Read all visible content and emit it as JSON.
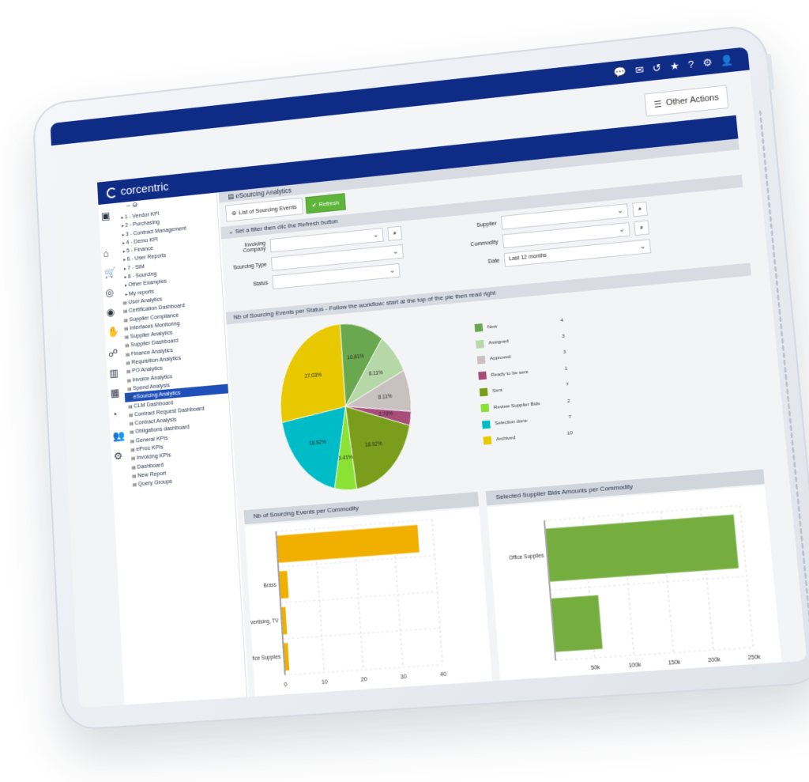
{
  "topbar": {
    "icons": [
      "chat-icon",
      "mail-icon",
      "history-icon",
      "star-icon",
      "help-icon",
      "gear-icon",
      "user-icon"
    ],
    "glyphs": [
      "💬",
      "✉",
      "↺",
      "★",
      "?",
      "⚙",
      "👤"
    ]
  },
  "other_actions_label": "Other Actions",
  "brand": {
    "name": "corcentric"
  },
  "rail_icons": [
    "sidebar-toggle-icon",
    "home-icon",
    "cart-icon",
    "coins-icon",
    "chart-search-icon",
    "handshake-icon",
    "hand-coins-icon",
    "bar-chart-icon",
    "dashboard-icon",
    "gauge-icon",
    "users-icon",
    "gears-icon"
  ],
  "rail_glyphs": [
    "▣",
    "⌂",
    "🛒",
    "◎",
    "◉",
    "✋",
    "☍",
    "▥",
    "▦",
    "◔",
    "👥",
    "⚙"
  ],
  "tree": {
    "head": "– ⊖",
    "items": [
      {
        "label": "1 - Vendor KPI",
        "kind": "caret"
      },
      {
        "label": "2 - Purchasing",
        "kind": "caret"
      },
      {
        "label": "3 - Contract Management",
        "kind": "caret"
      },
      {
        "label": "4 - Demo KPI",
        "kind": "caret"
      },
      {
        "label": "5 - Finance",
        "kind": "caret"
      },
      {
        "label": "6 - User Reports",
        "kind": "caret"
      },
      {
        "label": "7 - SIM",
        "kind": "caret"
      },
      {
        "label": "8 - Sourcing",
        "kind": "caret"
      },
      {
        "label": "Other Examples",
        "kind": "caret"
      },
      {
        "label": "My reports",
        "kind": "caret"
      },
      {
        "label": "User Analytics",
        "kind": "lvl2"
      },
      {
        "label": "Certification Dashboard",
        "kind": "lvl2"
      },
      {
        "label": "Supplier Compliance",
        "kind": "lvl2"
      },
      {
        "label": "Interfaces Monitoring",
        "kind": "lvl2"
      },
      {
        "label": "Supplier Analytics",
        "kind": "lvl2"
      },
      {
        "label": "Supplier Dashboard",
        "kind": "lvl2"
      },
      {
        "label": "Finance Analytics",
        "kind": "lvl2"
      },
      {
        "label": "Requisition Analytics",
        "kind": "lvl2"
      },
      {
        "label": "PO Analytics",
        "kind": "lvl2"
      },
      {
        "label": "Invoice Analytics",
        "kind": "lvl2"
      },
      {
        "label": "Spend Analysis",
        "kind": "lvl2"
      },
      {
        "label": "eSourcing Analytics",
        "kind": "lvl2",
        "selected": true
      },
      {
        "label": "CLM Dashboard",
        "kind": "lvl2"
      },
      {
        "label": "Contract Request Dashboard",
        "kind": "lvl2"
      },
      {
        "label": "Contract Analysis",
        "kind": "lvl2"
      },
      {
        "label": "Obligations dashboard",
        "kind": "lvl2"
      },
      {
        "label": "General KPIs",
        "kind": "lvl2"
      },
      {
        "label": "eProc KPIs",
        "kind": "lvl2"
      },
      {
        "label": "Invoicing KPIs",
        "kind": "lvl2"
      },
      {
        "label": "Dashboard",
        "kind": "lvl2"
      },
      {
        "label": "New Report",
        "kind": "lvl2"
      },
      {
        "label": "Query Groups",
        "kind": "lvl2"
      }
    ]
  },
  "main": {
    "title": "eSourcing Analytics",
    "list_button": "List of Sourcing Events",
    "refresh_button": "Refresh",
    "filter_section": "Set a filter then clic the Refresh button",
    "filters": {
      "invoicing_company_label": "Invoicing Company",
      "sourcing_type_label": "Sourcing Type",
      "status_label": "Status",
      "supplier_label": "Supplier",
      "commodity_label": "Commodity",
      "date_label": "Date",
      "date_value": "Last 12 months"
    },
    "pie_section": "Nb of Sourcing Events per Status - Follow the workflow: start at the top of the pie then read right",
    "commodity_section": "Nb of Sourcing Events per Commodity",
    "bids_section": "Selected Supplier Bids Amounts per Commodity"
  },
  "chart_data": [
    {
      "type": "pie",
      "title": "Nb of Sourcing Events per Status - Follow the workflow: start at the top of the pie then read right",
      "slices": [
        {
          "name": "New",
          "value": 4,
          "label": "10.81%",
          "color": "#6aa84f"
        },
        {
          "name": "Assigned",
          "value": 3,
          "label": "8.11%",
          "color": "#b6d7a8"
        },
        {
          "name": "Approved",
          "value": 3,
          "label": "8.11%",
          "color": "#c9c0c0"
        },
        {
          "name": "Ready to be sent",
          "value": 1,
          "label": "2.70%",
          "color": "#a64d79"
        },
        {
          "name": "Sent",
          "value": 7,
          "label": "18.92%",
          "color": "#7a9e1c"
        },
        {
          "name": "Review Supplier Bids",
          "value": 2,
          "label": "5.41%",
          "color": "#8ae234"
        },
        {
          "name": "Selection done",
          "value": 7,
          "label": "18.92%",
          "color": "#00bcc6"
        },
        {
          "name": "Archived",
          "value": 10,
          "label": "27.03%",
          "color": "#e8c800"
        }
      ]
    },
    {
      "type": "bar",
      "orientation": "horizontal",
      "title": "Nb of Sourcing Events per Commodity",
      "categories": [
        "",
        "Brass",
        "Advertising, TV",
        "Office Supplies"
      ],
      "values": [
        36,
        2,
        1,
        1
      ],
      "xticks": [
        0,
        10,
        20,
        30,
        40
      ],
      "xlim": [
        0,
        40
      ],
      "color": "#f1b000"
    },
    {
      "type": "bar",
      "orientation": "horizontal",
      "title": "Selected Supplier Bids Amounts per Commodity",
      "categories": [
        "Office Supplies",
        ""
      ],
      "values": [
        240000,
        60000
      ],
      "xticks": [
        "50k",
        "100k",
        "150k",
        "200k",
        "250k"
      ],
      "xlim": [
        0,
        250000
      ],
      "color": "#76ad3f"
    }
  ]
}
